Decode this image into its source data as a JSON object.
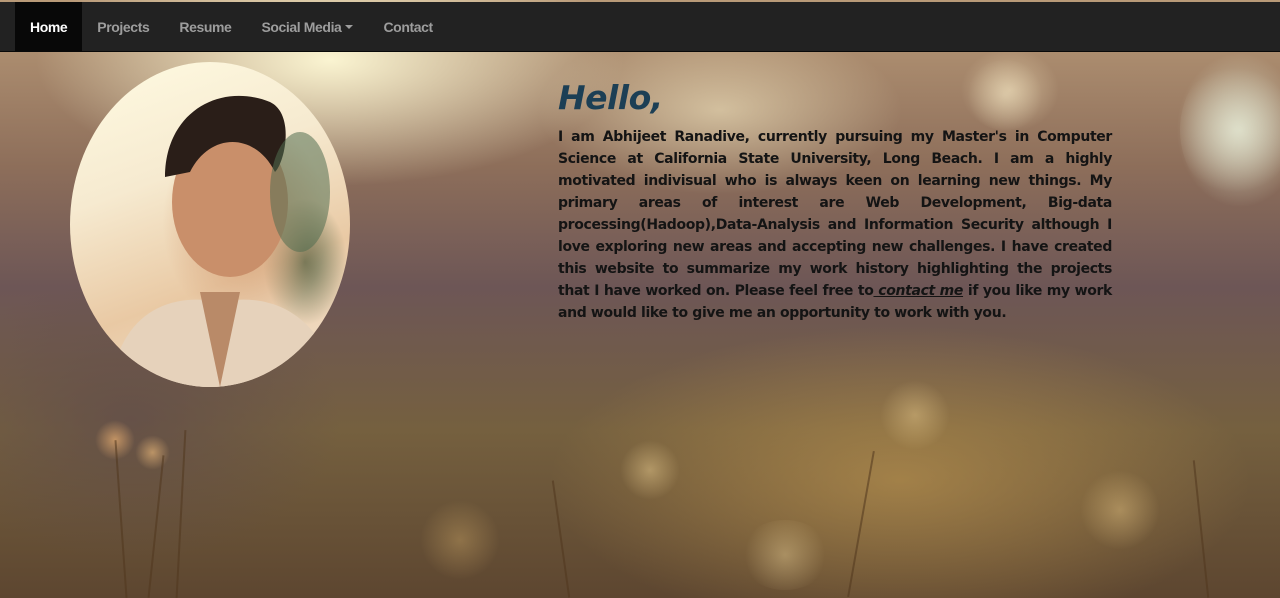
{
  "nav": {
    "items": [
      {
        "label": "Home",
        "active": true
      },
      {
        "label": "Projects",
        "active": false
      },
      {
        "label": "Resume",
        "active": false
      },
      {
        "label": "Social Media",
        "active": false,
        "dropdown": true
      },
      {
        "label": "Contact",
        "active": false
      }
    ]
  },
  "hero": {
    "greeting": "Hello,",
    "intro_before": "I am Abhijeet Ranadive, currently pursuing my Master's in Computer Science at California State University, Long Beach. I am a highly motivated indivisual who is always keen on learning new things. My primary areas of interest are Web Development, Big-data processing(Hadoop),Data-Analysis and Information Security although I love exploring new areas and accepting new challenges. I have created this website to summarize my work history highlighting the projects that I have worked on. Please feel free to",
    "contact_link": " contact me",
    "intro_after": " if you like my work and would like to give me an opportunity to work with you."
  },
  "colors": {
    "navbar_bg": "#222222",
    "nav_active_bg": "#080808",
    "nav_text": "#9d9d9d",
    "greeting": "#1c3f55"
  },
  "icons": {
    "dropdown": "caret-down-icon"
  }
}
